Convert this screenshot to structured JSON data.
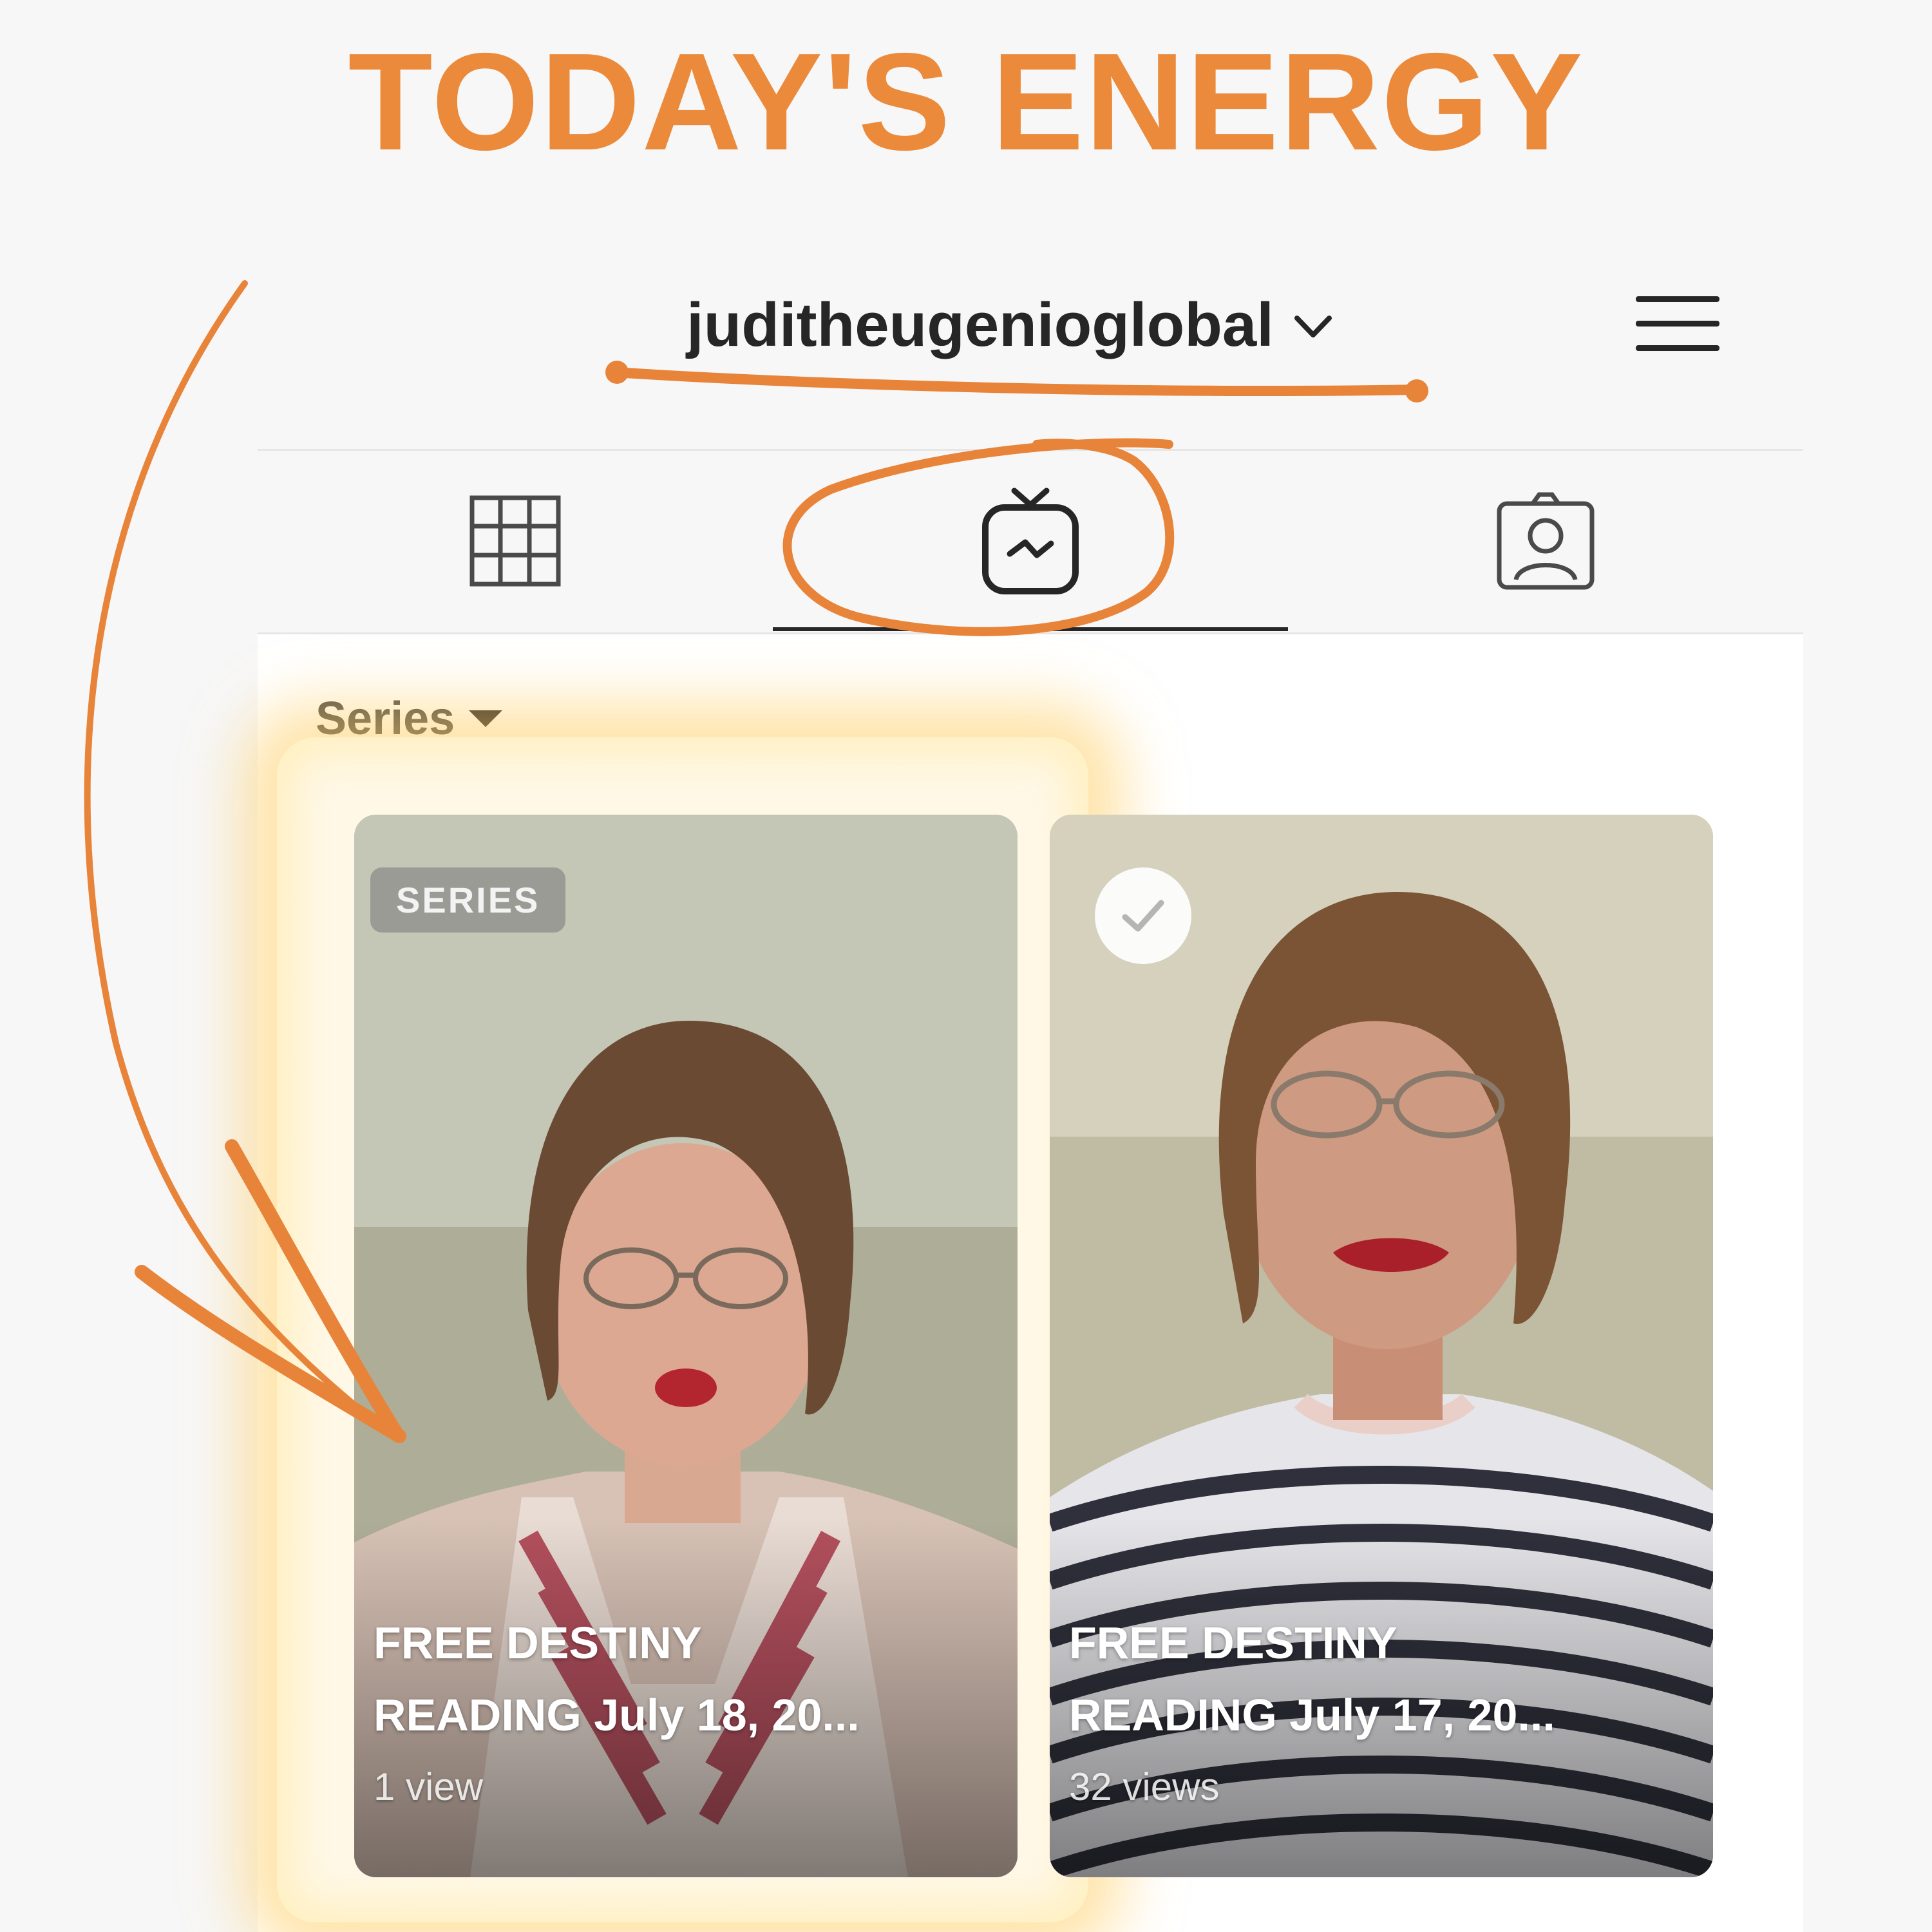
{
  "headline": "TODAY'S ENERGY",
  "profile": {
    "username": "juditheugenioglobal"
  },
  "tabs": [
    {
      "name": "grid",
      "icon": "grid-icon",
      "active": false
    },
    {
      "name": "igtv",
      "icon": "igtv-icon",
      "active": true
    },
    {
      "name": "tagged",
      "icon": "tagged-person-icon",
      "active": false
    }
  ],
  "filter": {
    "label": "Series"
  },
  "videos": [
    {
      "badge": "SERIES",
      "title_line1": "FREE DESTINY",
      "title_line2": "READING July 18, 20...",
      "views": "1 view",
      "highlighted": true
    },
    {
      "badge_icon": "checkmark-icon",
      "title_line1": "FREE DESTINY",
      "title_line2": "READING July 17, 20...",
      "views": "32 views",
      "highlighted": false
    }
  ],
  "colors": {
    "accent_orange": "#ec8a3b",
    "text_dark": "#262626",
    "background": "#f7f7f7"
  }
}
